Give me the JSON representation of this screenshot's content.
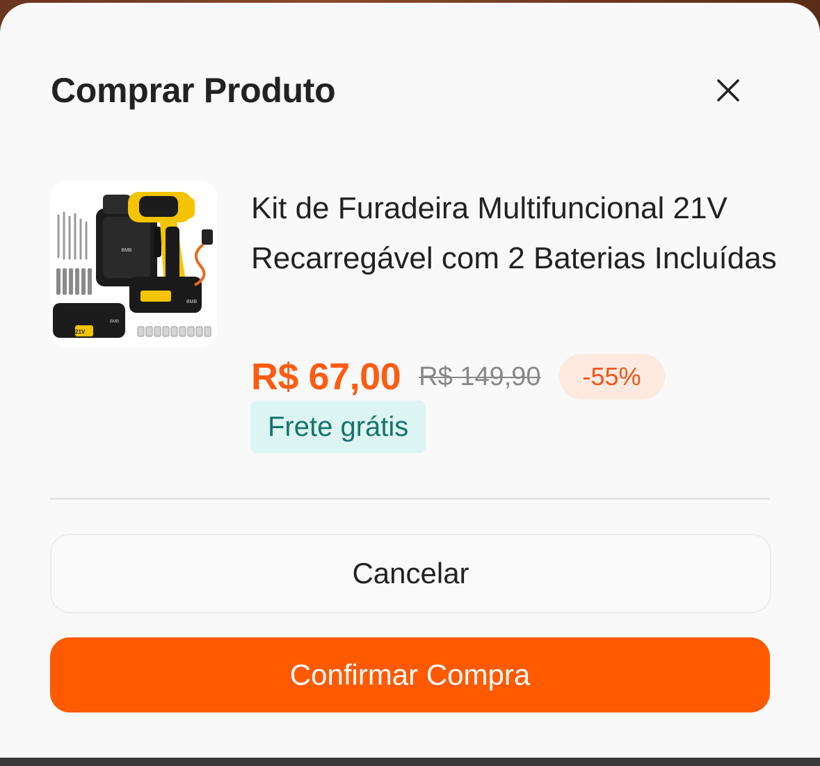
{
  "modal": {
    "title": "Comprar Produto"
  },
  "product": {
    "image_alt": "Kit de Furadeira Multifuncional 21V Recarregável com 2 Baterias Incluídas",
    "name": "Kit de Furadeira Multifuncional 21V Recarregável com 2 Baterias Incluídas",
    "price_current": "R$ 67,00",
    "price_original": "R$ 149,90",
    "discount": "-55%",
    "shipping": "Frete grátis"
  },
  "actions": {
    "cancel_label": "Cancelar",
    "confirm_label": "Confirmar Compra"
  },
  "icons": {
    "close": "close-icon"
  },
  "colors": {
    "accent": "#ff5a00",
    "price": "#ff5c12",
    "discount_bg": "#fde9e0",
    "shipping_bg": "#dcf5f3",
    "shipping_text": "#17736a"
  }
}
